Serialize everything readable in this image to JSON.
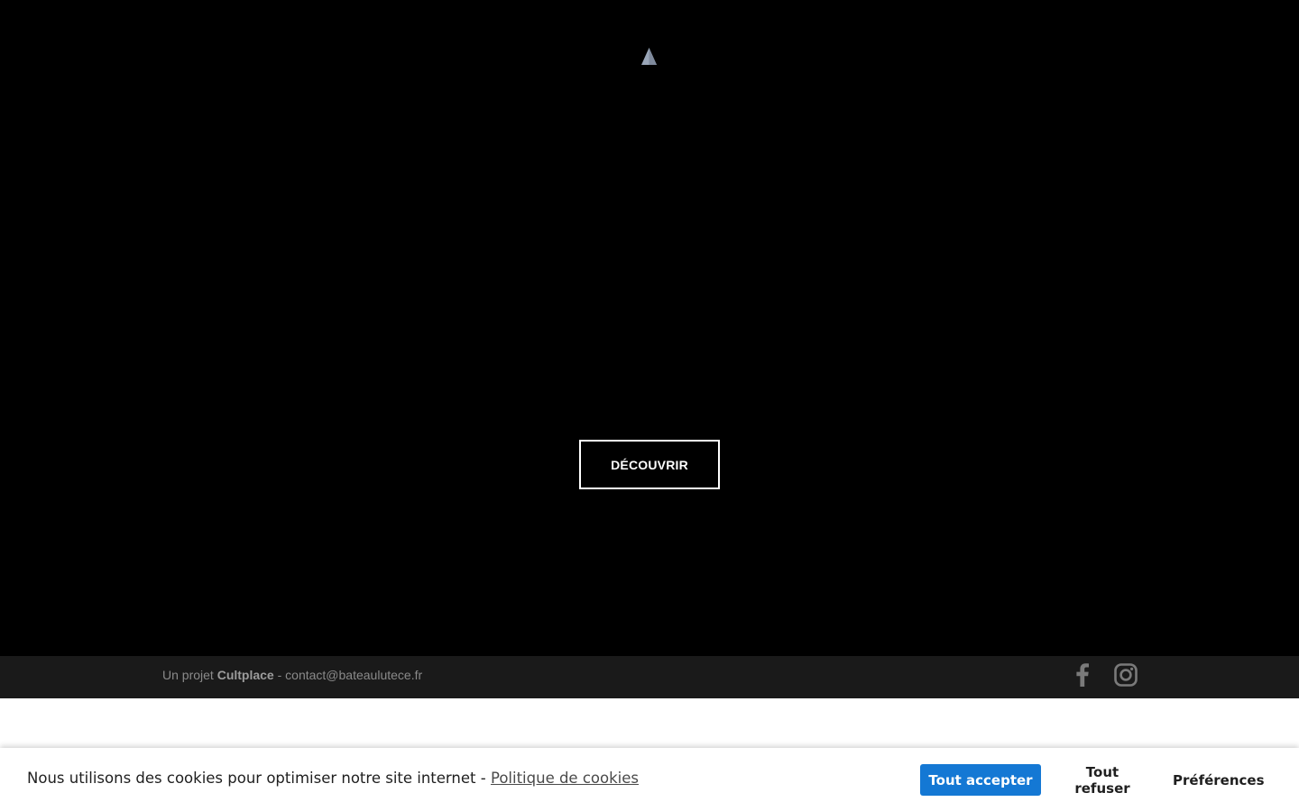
{
  "hero": {
    "cta_label": "DÉCOUVRIR",
    "background_color": "#000000"
  },
  "footer": {
    "prefix": "Un projet ",
    "brand": "Cultplace",
    "separator": " - ",
    "email": "contact@bateaulutece.fr",
    "social_icons": [
      "facebook-icon",
      "instagram-icon"
    ]
  },
  "cookie_banner": {
    "message": "Nous utilisons des cookies pour optimiser notre site internet - ",
    "policy_link": "Politique de cookies",
    "accept_label": "Tout accepter",
    "refuse_label": "Tout refuser",
    "preferences_label": "Préférences",
    "accent_color": "#1478d4"
  }
}
